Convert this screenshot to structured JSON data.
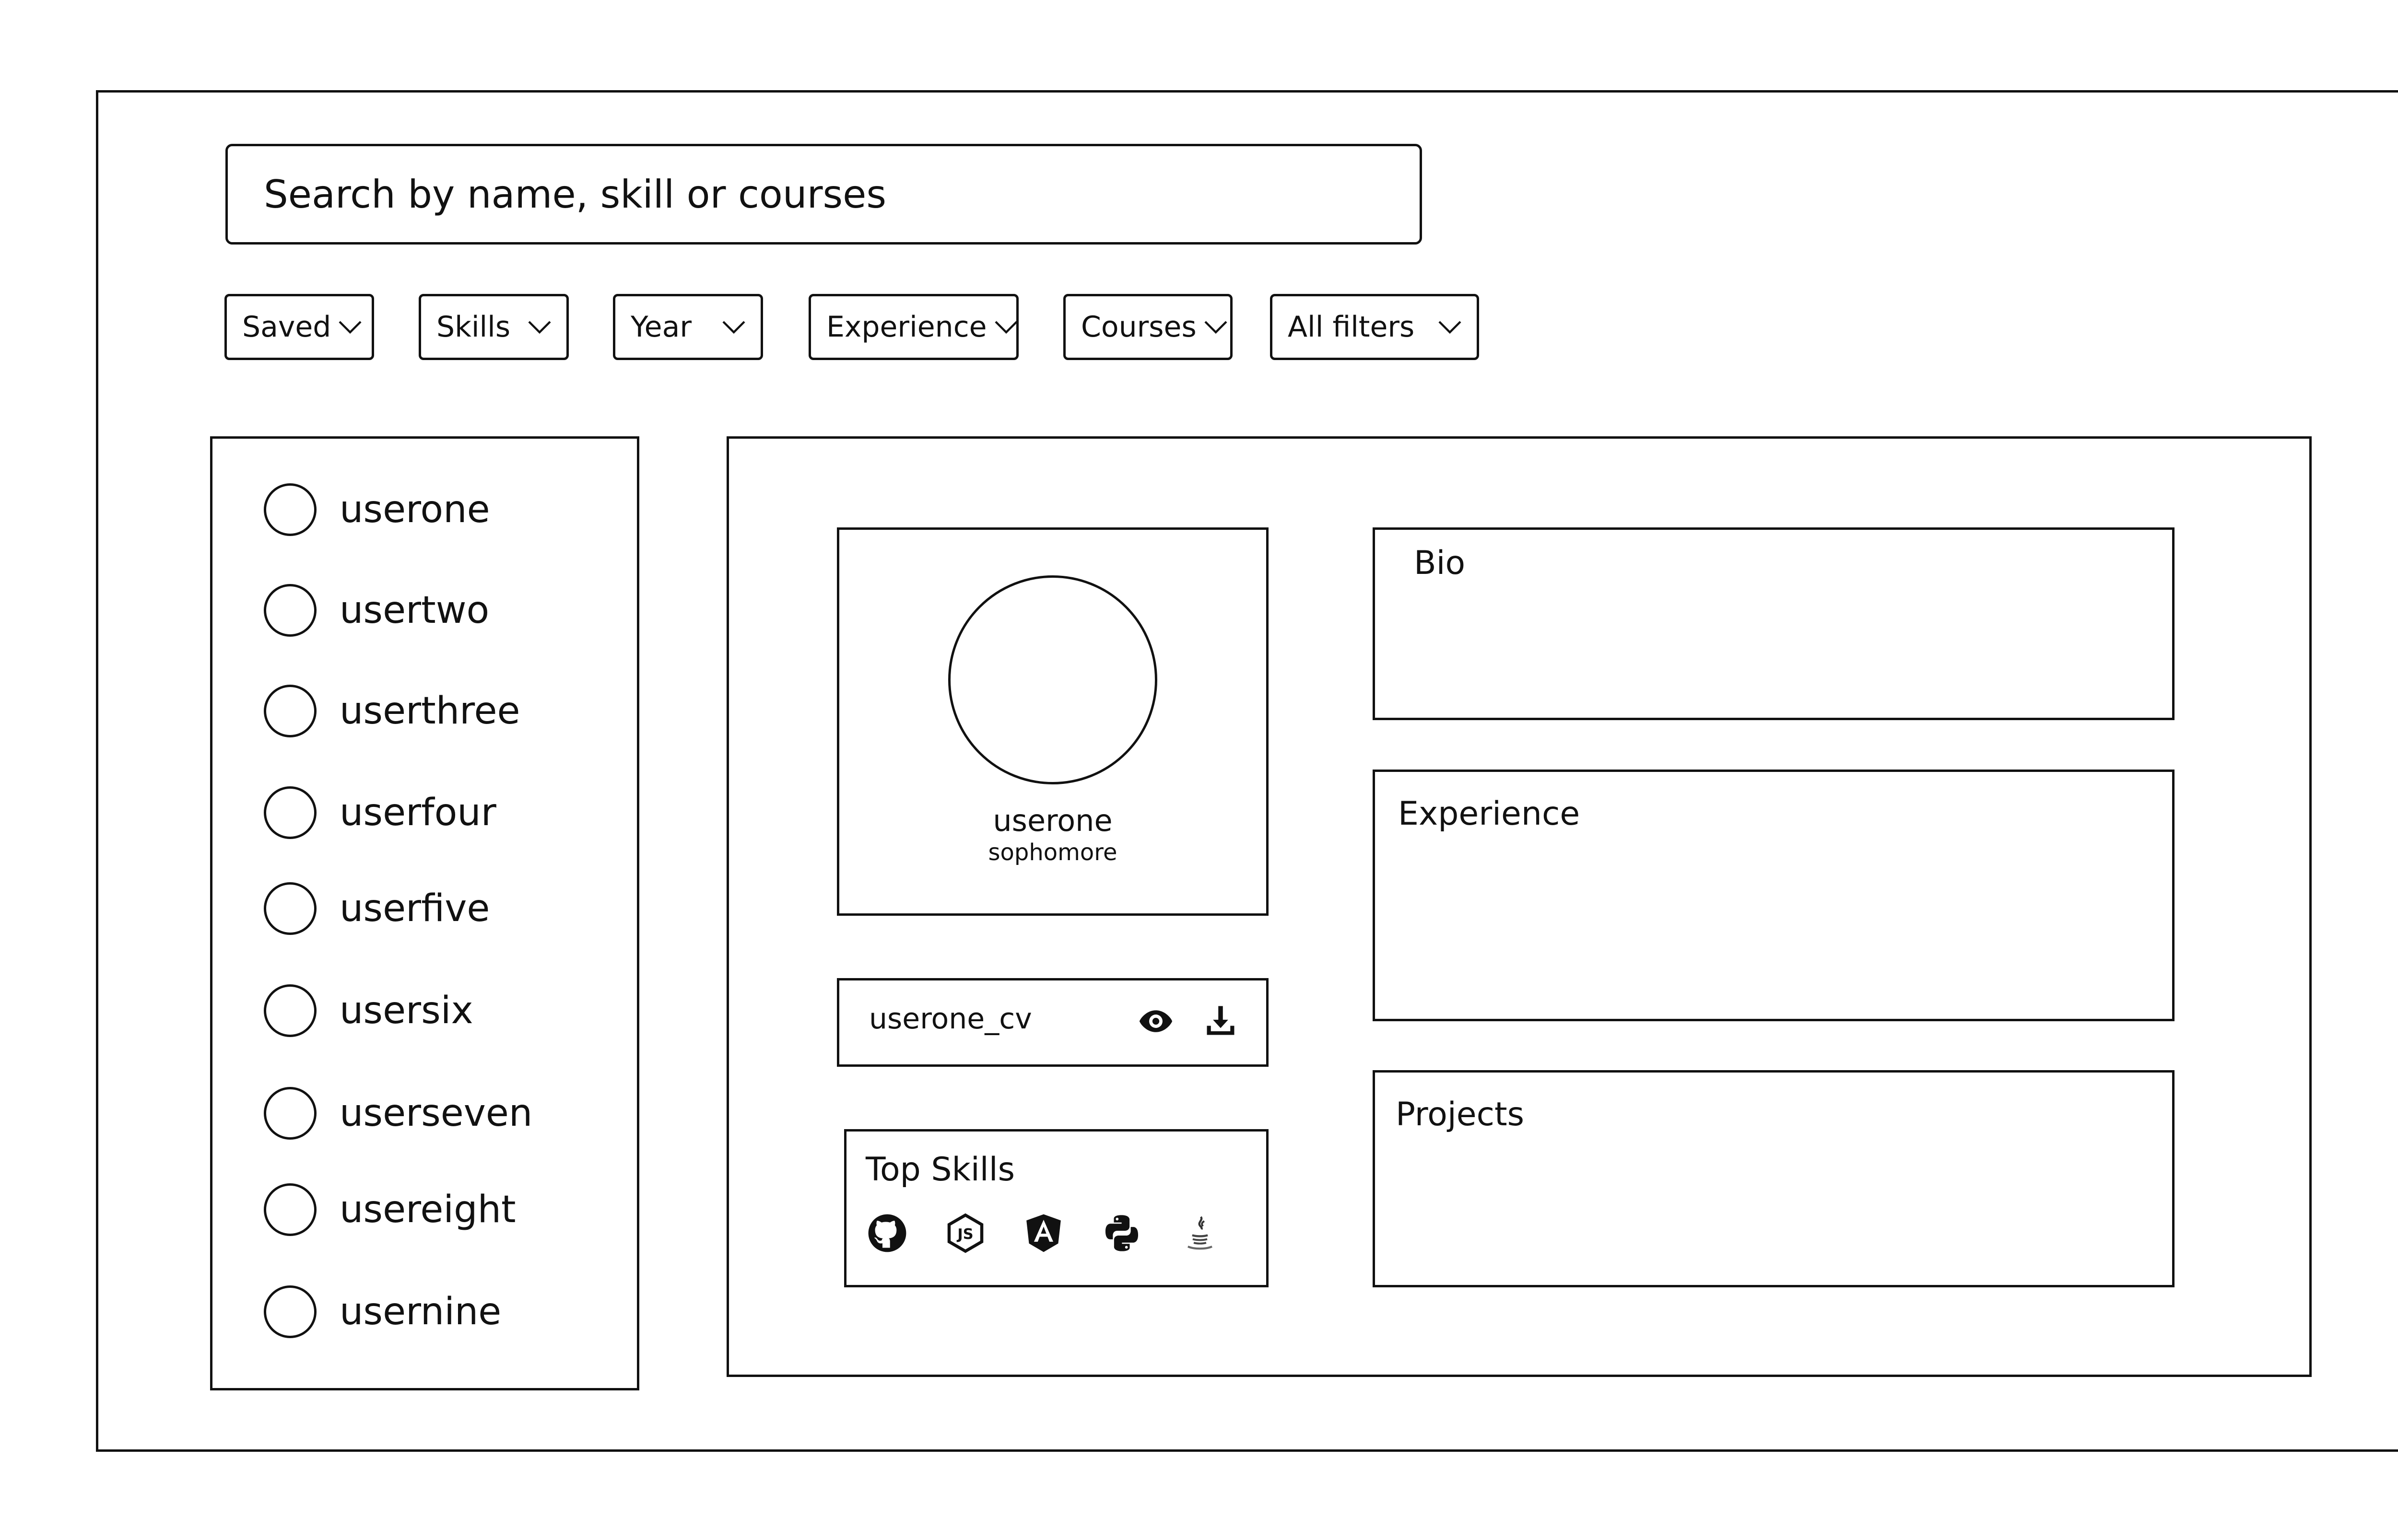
{
  "search": {
    "placeholder": "Search by name, skill or courses"
  },
  "filters": [
    {
      "label": "Saved",
      "icon": "chevron-down-icon"
    },
    {
      "label": "Skills",
      "icon": "chevron-down-icon"
    },
    {
      "label": "Year",
      "icon": "chevron-down-icon"
    },
    {
      "label": "Experience",
      "icon": "chevron-down-icon"
    },
    {
      "label": "Courses",
      "icon": "chevron-down-icon"
    },
    {
      "label": "All filters",
      "icon": "chevron-down-icon"
    }
  ],
  "users": [
    {
      "name": "userone"
    },
    {
      "name": "usertwo"
    },
    {
      "name": "userthree"
    },
    {
      "name": "userfour"
    },
    {
      "name": "userfive"
    },
    {
      "name": "usersix"
    },
    {
      "name": "userseven"
    },
    {
      "name": "usereight"
    },
    {
      "name": "usernine"
    }
  ],
  "profile": {
    "name": "userone",
    "year": "sophomore",
    "cv": {
      "filename": "userone_cv",
      "view_icon": "eye-icon",
      "download_icon": "download-icon"
    },
    "top_skills": {
      "title": "Top Skills",
      "icons": [
        "github-icon",
        "nodejs-icon",
        "angular-icon",
        "python-icon",
        "java-icon"
      ]
    },
    "sections": {
      "bio": "Bio",
      "experience": "Experience",
      "projects": "Projects"
    }
  }
}
